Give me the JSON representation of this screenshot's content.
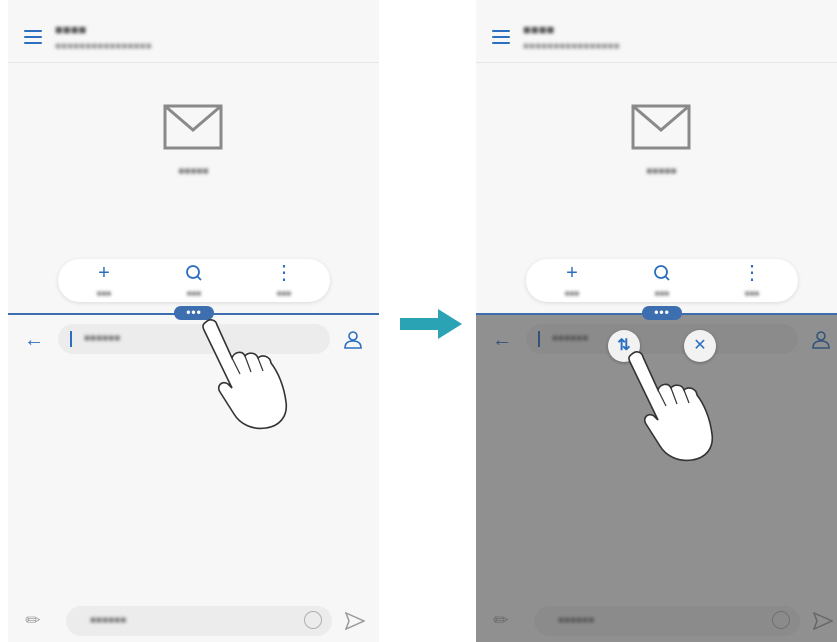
{
  "before_screen": {
    "header": {
      "account_name": "■■■■",
      "account_email": "■■■■■■■■■■■■■■■■"
    },
    "empty_state": {
      "icon": "envelope-icon",
      "text": "■■■■■"
    },
    "toolbar": {
      "items": [
        {
          "icon": "plus-icon",
          "glyph": "+",
          "label": "■■■"
        },
        {
          "icon": "search-icon",
          "glyph": "⚲",
          "label": "■■■"
        },
        {
          "icon": "more-icon",
          "glyph": "⋮",
          "label": "■■■"
        }
      ]
    },
    "split_handle": "•••",
    "compose": {
      "to_placeholder": "■■■■■■",
      "message_placeholder": "■■■■■■"
    }
  },
  "after_screen": {
    "header": {
      "account_name": "■■■■",
      "account_email": "■■■■■■■■■■■■■■■■"
    },
    "empty_state": {
      "icon": "envelope-icon",
      "text": "■■■■■"
    },
    "toolbar": {
      "items": [
        {
          "icon": "plus-icon",
          "glyph": "+",
          "label": "■■■"
        },
        {
          "icon": "search-icon",
          "glyph": "⚲",
          "label": "■■■"
        },
        {
          "icon": "more-icon",
          "glyph": "⋮",
          "label": "■■■"
        }
      ]
    },
    "split_handle": "•••",
    "split_actions": {
      "swap_glyph": "⇅",
      "close_glyph": "✕"
    },
    "compose": {
      "to_placeholder": "■■■■■■",
      "message_placeholder": "■■■■■■"
    }
  },
  "colors": {
    "accent": "#2b6fc0",
    "divider": "#3c6eb0",
    "arrow": "#2aa3b5",
    "overlay": "#5a5a5a"
  }
}
